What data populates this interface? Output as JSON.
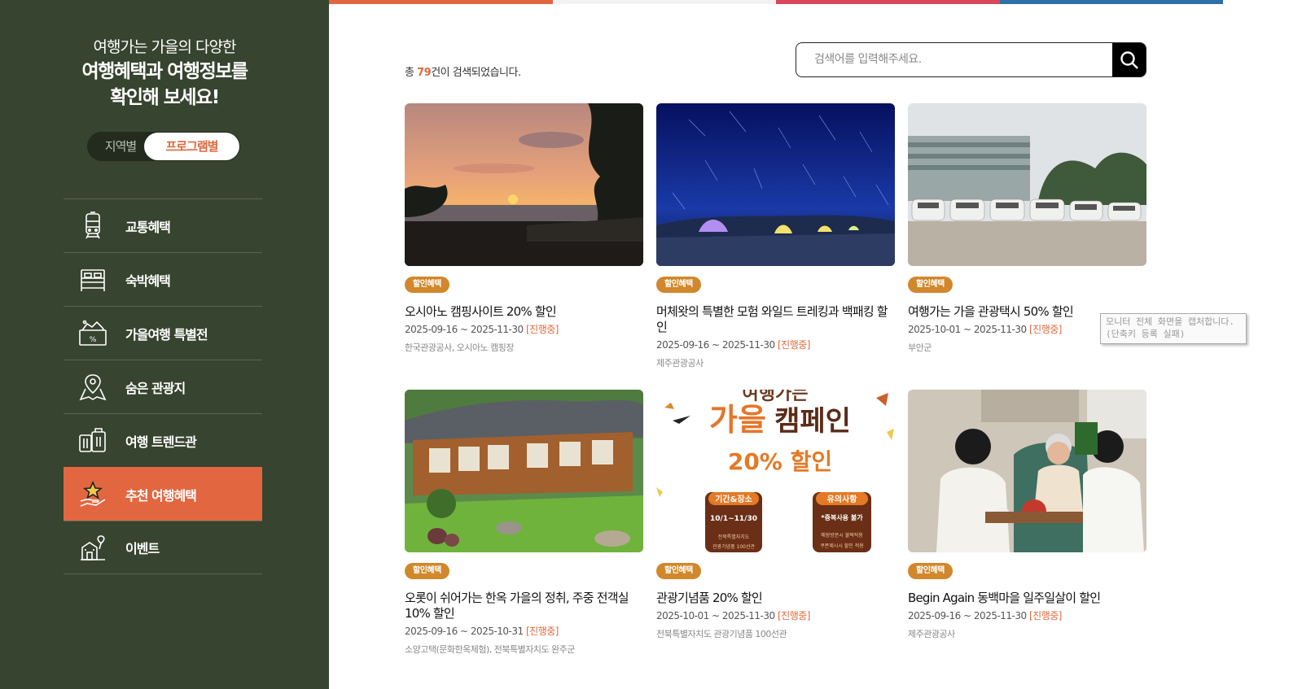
{
  "sidebar": {
    "headline_line1": "여행가는 가을의 다양한",
    "headline_line2": "여행혜택과 여행정보를",
    "headline_line3": "확인해 보세요!",
    "toggle": {
      "region": "지역별",
      "program": "프로그램별",
      "selected": "프로그램별"
    },
    "menu": [
      {
        "label": "교통혜택",
        "icon": "train-icon"
      },
      {
        "label": "숙박혜택",
        "icon": "bed-icon"
      },
      {
        "label": "가을여행 특별전",
        "icon": "discount-tag-icon"
      },
      {
        "label": "숨은 관광지",
        "icon": "map-pin-icon"
      },
      {
        "label": "여행 트렌드관",
        "icon": "luggage-icon"
      },
      {
        "label": "추천 여행혜택",
        "icon": "star-hand-icon",
        "active": true
      },
      {
        "label": "이벤트",
        "icon": "balloon-building-icon"
      }
    ]
  },
  "colors": {
    "sidebar_bg": "#37442f",
    "accent": "#e26741",
    "badge": "#d1872c",
    "topbar": [
      "#e26741",
      "#ffffff",
      "#d9485a",
      "#2f6faa"
    ]
  },
  "results": {
    "prefix": "총 ",
    "count": "79",
    "suffix": "건이 검색되었습니다."
  },
  "search": {
    "placeholder": "검색어를 입력해주세요.",
    "value": ""
  },
  "cards": [
    {
      "badge": "할인혜택",
      "title": "오시아노 캠핑사이트 20% 할인",
      "date": "2025-09-16 ~ 2025-11-30",
      "status": "[진행중]",
      "org": "한국관광공사, 오시아노 캠핑장"
    },
    {
      "badge": "할인혜택",
      "title": "머체왓의 특별한 모험 와일드 트레킹과 백패킹 할인",
      "date": "2025-09-16 ~ 2025-11-30",
      "status": "[진행중]",
      "org": "제주관광공사"
    },
    {
      "badge": "할인혜택",
      "title": "여행가는 가을 관광택시 50% 할인",
      "date": "2025-10-01 ~ 2025-11-30",
      "status": "[진행중]",
      "org": "부안군"
    },
    {
      "badge": "할인혜택",
      "title": "오롯이 쉬어가는 한옥 가을의 정취, 주중 전객실 10% 할인",
      "date": "2025-09-16 ~ 2025-10-31",
      "status": "[진행중]",
      "org": "소양고택(문화한옥체험), 전북특별자치도 완주군"
    },
    {
      "badge": "할인혜택",
      "title": "관광기념품 20% 할인",
      "date": "2025-10-01 ~ 2025-11-30",
      "status": "[진행중]",
      "org": "전북특별자치도 관광기념품 100선관"
    },
    {
      "badge": "할인혜택",
      "title": "Begin Again 동백마을 일주일살이 할인",
      "date": "2025-09-16 ~ 2025-11-30",
      "status": "[진행중]",
      "org": "제주관광공사"
    }
  ],
  "poster": {
    "top": "여행가는",
    "headline_a": "가을",
    "headline_b": "캠페인",
    "discount": "20% 할인",
    "box1_title": "기간&장소",
    "box1_line1": "10/1~11/30",
    "box1_line2": "전북특별자치도",
    "box1_line3": "관광기념품 100선관",
    "box2_title": "유의사항",
    "box2_line1": "*중복사용 불가",
    "box2_line2": "매장방문시 불택적용",
    "box2_line3": "쿠폰제시시 할인 적용"
  },
  "tooltip": {
    "line1": "모니터 전체 화면을 캡처합니다.",
    "line2": "(단축키 등록 실패)"
  }
}
